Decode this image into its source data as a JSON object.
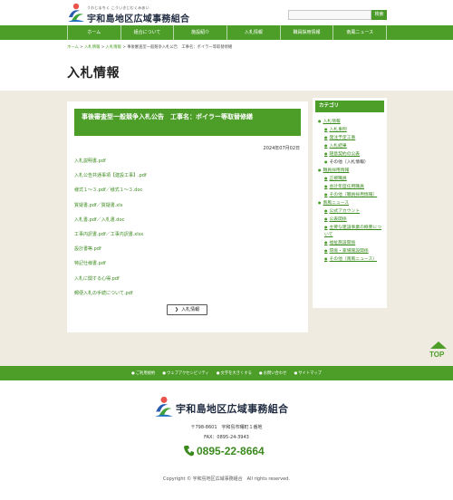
{
  "header": {
    "logo_kana": "うわじまちく こういきじむくみあい",
    "logo_name": "宇和島地区広域事務組合",
    "search_placeholder": "",
    "search_button": "検索"
  },
  "nav": {
    "items": [
      {
        "label": "ホーム"
      },
      {
        "label": "組合について"
      },
      {
        "label": "施設紹介"
      },
      {
        "label": "入札情報"
      },
      {
        "label": "職員採用情報"
      },
      {
        "label": "南風ニュース"
      }
    ]
  },
  "breadcrumb": {
    "home": "ホーム",
    "sep": ">",
    "level1": "入札情報",
    "level2": "入札情報",
    "current": "事後審査型一般競争入札公告　工事名：ボイラー等取替修繕"
  },
  "page_title": "入札情報",
  "notice": {
    "title": "事後審査型一般競争入札公告　工事名：ボイラー等取替修繕",
    "date": "2024年07月02日",
    "documents": [
      "入札説明書.pdf",
      "入札公告共通事項【建設工事】.pdf",
      "様式１～３.pdf／様式１～３.doc",
      "質疑書.pdf／質疑書.xls",
      "入札書.pdf／入札書.doc",
      "工事内訳書.pdf／工事内訳書.xlsx",
      "設計書等.pdf",
      "特記仕様書.pdf",
      "入札に関する心得.pdf",
      "郵便入札の手続について.pdf"
    ],
    "back_button": "入札情報"
  },
  "sidebar": {
    "heading": "カテゴリ",
    "categories": [
      {
        "label": "入札情報",
        "items": [
          {
            "label": "入札事例"
          },
          {
            "label": "発注予定工事"
          },
          {
            "label": "入札結果"
          },
          {
            "label": "随意契約の公表"
          },
          {
            "label": "その他（入札情報）"
          }
        ]
      },
      {
        "label": "職員採用情報",
        "items": [
          {
            "label": "正規職員"
          },
          {
            "label": "会計年度任用職員"
          },
          {
            "label": "その他（職員採用情報）"
          }
        ]
      },
      {
        "label": "南風ニュース",
        "items": [
          {
            "label": "公式アカウント"
          },
          {
            "label": "公表関係"
          },
          {
            "label": "主要な建設事業の概要について"
          },
          {
            "label": "福祉施設関係"
          },
          {
            "label": "環境・家場施設関係"
          },
          {
            "label": "その他（南風ニュース）"
          }
        ]
      }
    ]
  },
  "top_button": "TOP",
  "footer_nav": {
    "items": [
      {
        "label": "ご利用規約"
      },
      {
        "label": "ウェブアクセシビリティ"
      },
      {
        "label": "文字を大きくする"
      },
      {
        "label": "お問い合わせ"
      },
      {
        "label": "サイトマップ"
      }
    ]
  },
  "footer": {
    "name": "宇和島地区広域事務組合",
    "address": "〒798-8601　宇和島市曙町１番地",
    "fax": "FAX：0895-24-3943",
    "phone": "0895-22-8664",
    "copyright": "Copyright © 宇和島地区広域事務組合　All rights reserved."
  },
  "colors": {
    "brand_green": "#4c9e29",
    "link_green": "#3a8a1e",
    "page_beige": "#efebe0",
    "logo_navy": "#1e2a40"
  }
}
